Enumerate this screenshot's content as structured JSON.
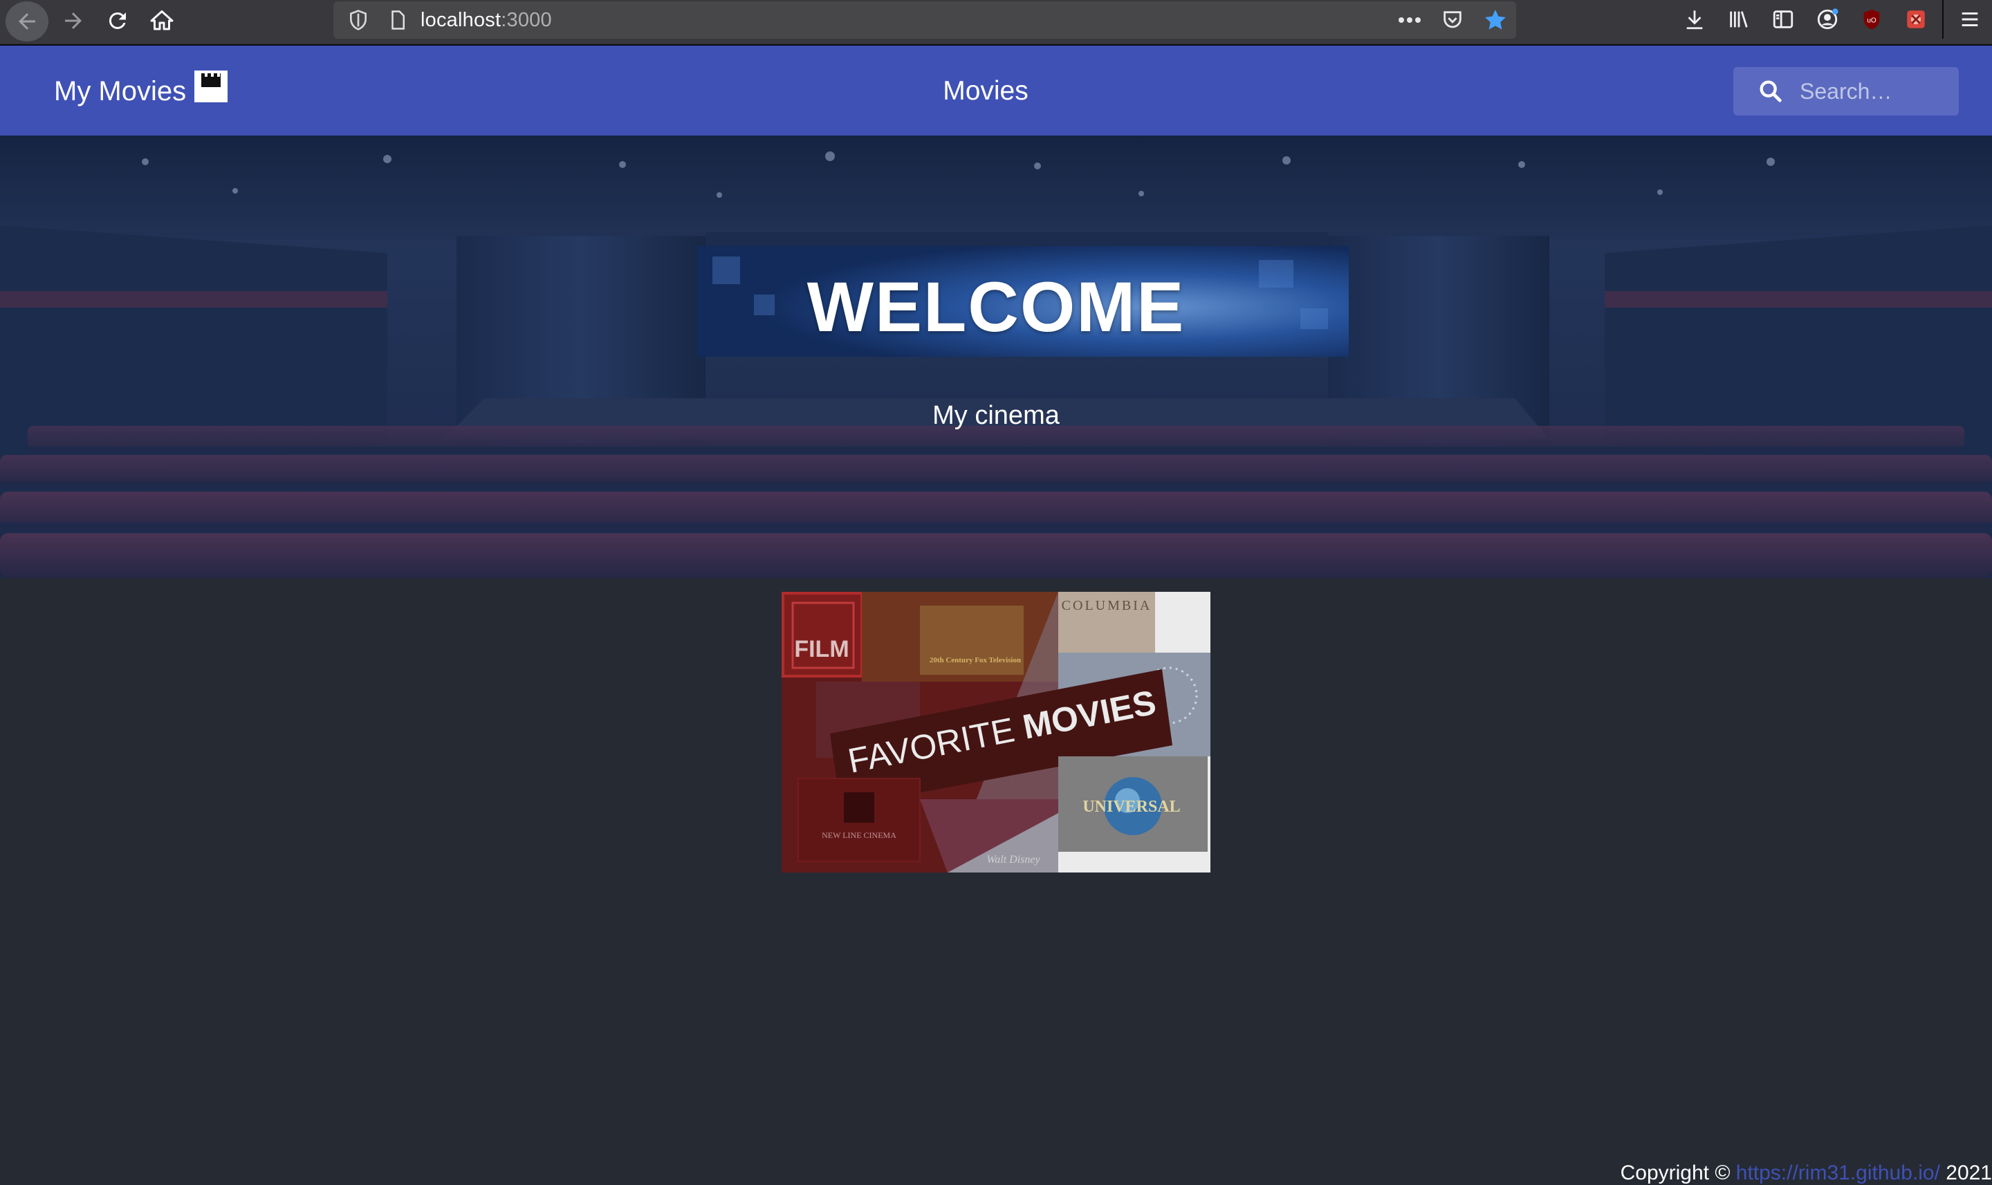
{
  "browser": {
    "url_host": "localhost",
    "url_port": ":3000"
  },
  "navbar": {
    "brand": "My Movies",
    "center_title": "Movies",
    "search_placeholder": "Search…",
    "accent_color": "#3f51b5"
  },
  "hero": {
    "title": "WELCOME",
    "subtitle": "My cinema"
  },
  "banner": {
    "film_text": "FILM",
    "favorite_text": "FAVORITE",
    "movies_text": "MOVIES",
    "logos": [
      "20th Century Fox Television",
      "COLUMBIA",
      "UNIVERSAL",
      "NEW LINE CINEMA",
      "Walt Disney"
    ]
  },
  "footer": {
    "prefix": "Copyright © ",
    "link": "https://rim31.github.io/",
    "year": " 2021"
  }
}
